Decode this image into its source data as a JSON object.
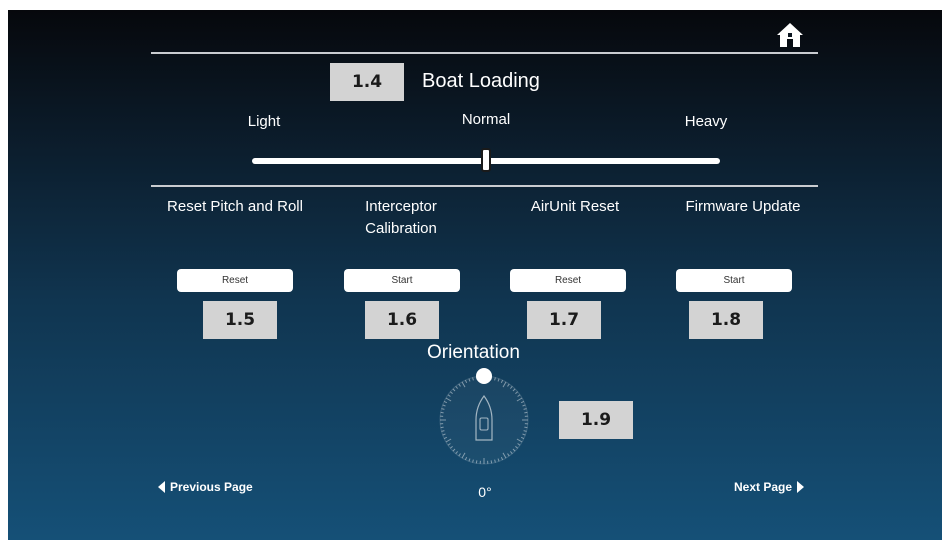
{
  "header": {
    "home_icon": "home-icon"
  },
  "boat_loading": {
    "tag": "1.4",
    "title": "Boat Loading",
    "labels": {
      "light": "Light",
      "normal": "Normal",
      "heavy": "Heavy"
    },
    "slider_value": 0.5
  },
  "actions": [
    {
      "title": "Reset Pitch and Roll",
      "button": "Reset",
      "tag": "1.5"
    },
    {
      "title": "Interceptor Calibration",
      "button": "Start",
      "tag": "1.6"
    },
    {
      "title": "AirUnit Reset",
      "button": "Reset",
      "tag": "1.7"
    },
    {
      "title": "Firmware Update",
      "button": "Start",
      "tag": "1.8"
    }
  ],
  "orientation": {
    "title": "Orientation",
    "tag": "1.9",
    "angle_text": "0°",
    "angle_deg": 0
  },
  "nav": {
    "previous": "Previous Page",
    "next": "Next Page"
  },
  "colors": {
    "panel_top": "#06080c",
    "panel_bottom": "#155077",
    "tag_bg": "#d3d3d3"
  }
}
